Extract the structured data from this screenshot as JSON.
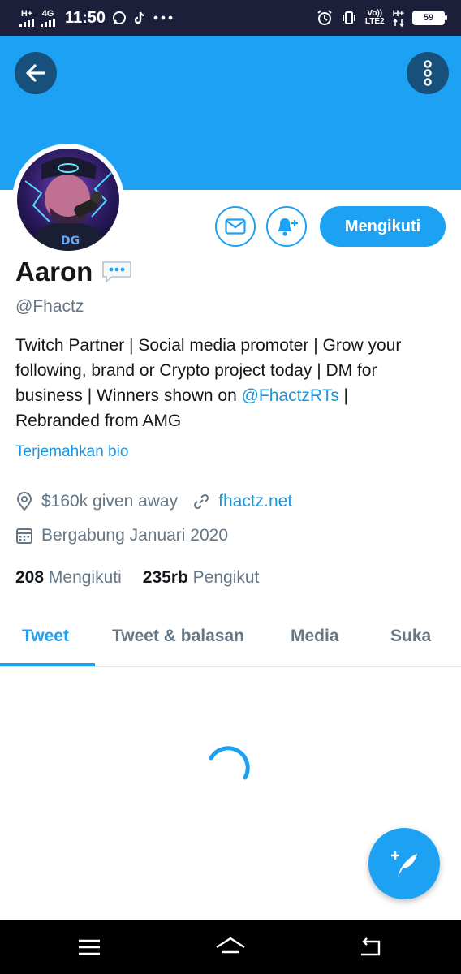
{
  "status_bar": {
    "net1": "H+",
    "net2": "4G",
    "time": "11:50",
    "lte_top": "Vo))",
    "lte_bottom": "LTE2",
    "net3": "H+",
    "battery": "59"
  },
  "colors": {
    "brand": "#1da1f2",
    "banner": "#1da1f2",
    "status_bar": "#1c1f3a",
    "text_primary": "#14171a",
    "text_secondary": "#657786",
    "link": "#1b95e0"
  },
  "profile": {
    "name": "Aaron",
    "handle": "@Fhactz",
    "bio_text": "Twitch Partner | Social media promoter | Grow your following, brand or Crypto project today | DM for business | Winners shown on ",
    "bio_link": "@FhactzRTs",
    "bio_after_link": " |",
    "bio_tail": "Rebranded from AMG",
    "translate_label": "Terjemahkan bio",
    "location": "$160k given away",
    "website": "fhactz.net",
    "joined": "Bergabung Januari 2020",
    "following_count": "208",
    "following_label": "Mengikuti",
    "followers_count": "235rb",
    "followers_label": "Pengikut"
  },
  "actions": {
    "follow_label": "Mengikuti"
  },
  "tabs": [
    {
      "label": "Tweet",
      "active": true
    },
    {
      "label": "Tweet & balasan",
      "active": false
    },
    {
      "label": "Media",
      "active": false
    },
    {
      "label": "Suka",
      "active": false
    }
  ],
  "icons": {
    "back": "arrow-left-icon",
    "more": "more-vertical-icon",
    "message": "envelope-icon",
    "notify": "bell-plus-icon",
    "location": "location-pin-icon",
    "link": "link-icon",
    "calendar": "calendar-icon",
    "compose": "compose-feather-icon"
  }
}
